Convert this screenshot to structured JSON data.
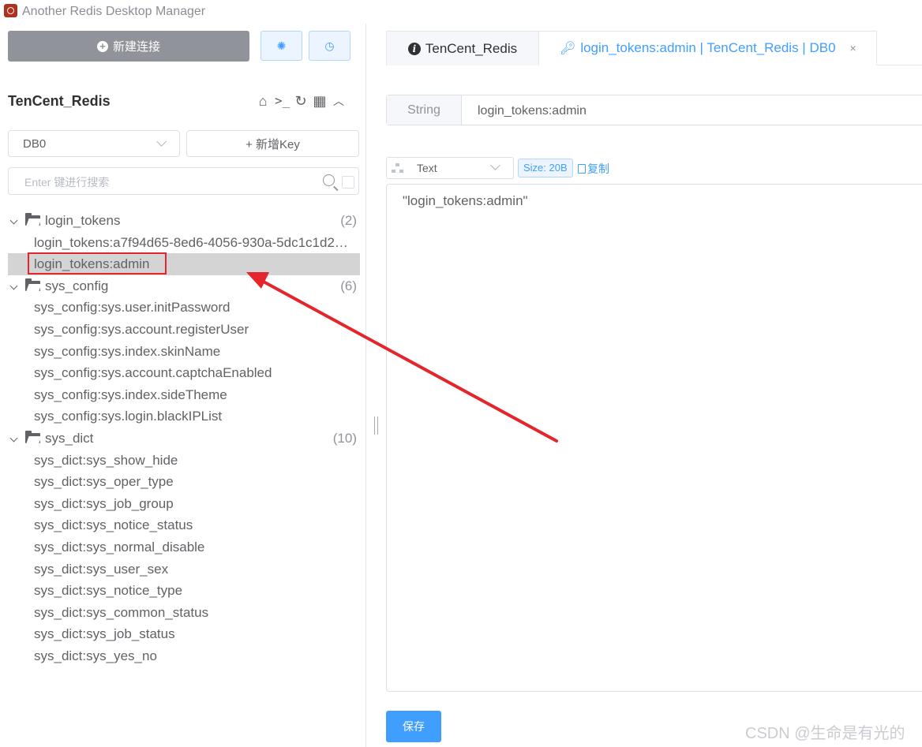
{
  "window": {
    "title": "Another Redis Desktop Manager"
  },
  "toolbar": {
    "new_connection_label": "新建连接",
    "settings_icon": "gear-icon",
    "history_icon": "clock-icon"
  },
  "connection": {
    "name": "TenCent_Redis"
  },
  "db_select": {
    "value": "DB0"
  },
  "add_key": {
    "label": "+ 新增Key"
  },
  "search": {
    "placeholder": "Enter 键进行搜索"
  },
  "tree": {
    "folders": [
      {
        "name": "login_tokens",
        "count": "(2)",
        "keys": [
          "login_tokens:a7f94d65-8ed6-4056-930a-5dc1c1d2…",
          "login_tokens:admin"
        ]
      },
      {
        "name": "sys_config",
        "count": "(6)",
        "keys": [
          "sys_config:sys.user.initPassword",
          "sys_config:sys.account.registerUser",
          "sys_config:sys.index.skinName",
          "sys_config:sys.account.captchaEnabled",
          "sys_config:sys.index.sideTheme",
          "sys_config:sys.login.blackIPList"
        ]
      },
      {
        "name": "sys_dict",
        "count": "(10)",
        "keys": [
          "sys_dict:sys_show_hide",
          "sys_dict:sys_oper_type",
          "sys_dict:sys_job_group",
          "sys_dict:sys_notice_status",
          "sys_dict:sys_normal_disable",
          "sys_dict:sys_user_sex",
          "sys_dict:sys_notice_type",
          "sys_dict:sys_common_status",
          "sys_dict:sys_job_status",
          "sys_dict:sys_yes_no"
        ]
      }
    ],
    "selected_key": "login_tokens:admin"
  },
  "tabs": [
    {
      "label": "TenCent_Redis"
    },
    {
      "label": "login_tokens:admin | TenCent_Redis | DB0",
      "close": "×"
    }
  ],
  "key_detail": {
    "type": "String",
    "name": "login_tokens:admin",
    "format": "Text",
    "size": "Size: 20B",
    "copy_label": "复制",
    "value": "\"login_tokens:admin\"",
    "save_label": "保存"
  },
  "watermark": "CSDN @生命是有光的",
  "colors": {
    "accent": "#409eff",
    "annotation": "#e4262c",
    "selected_row": "#d4d4d4"
  }
}
